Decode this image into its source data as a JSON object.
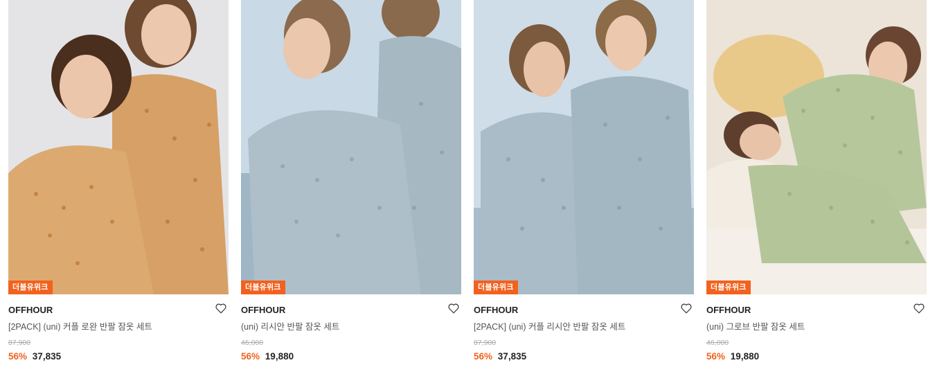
{
  "products": [
    {
      "badge": "더블유위크",
      "brand": "OFFHOUR",
      "name": "[2PACK] (uni) 커플 로완 반팔 잠옷 세트",
      "original_price": "87,900",
      "discount": "56%",
      "price": "37,835",
      "image": {
        "bg": "#e4e4e6",
        "garment": "#d9a66a",
        "pattern": "#b5651d",
        "skin": "#e8c3a8",
        "hair": "#5a3a26"
      }
    },
    {
      "badge": "더블유위크",
      "brand": "OFFHOUR",
      "name": "(uni) 리시안 반팔 잠옷 세트",
      "original_price": "46,000",
      "discount": "56%",
      "price": "19,880",
      "image": {
        "bg": "#c9d9e6",
        "garment": "#a6b8c2",
        "pattern": "#7e95a3",
        "skin": "#eac7ad",
        "hair": "#8b6a4e"
      }
    },
    {
      "badge": "더블유위크",
      "brand": "OFFHOUR",
      "name": "[2PACK] (uni) 커플 리시안 반팔 잠옷 세트",
      "original_price": "87,900",
      "discount": "56%",
      "price": "37,835",
      "image": {
        "bg": "#cfdde8",
        "garment": "#a3b7c3",
        "pattern": "#7a93a2",
        "skin": "#e8c3a8",
        "hair": "#7b5a3e"
      }
    },
    {
      "badge": "더블유위크",
      "brand": "OFFHOUR",
      "name": "(uni) 그로브 반팔 잠옷 세트",
      "original_price": "46,000",
      "discount": "56%",
      "price": "19,880",
      "image": {
        "bg": "#ece4d8",
        "garment": "#b5c59a",
        "pattern": "#8aa070",
        "skin": "#e8c3a8",
        "hair": "#6a4632"
      }
    }
  ]
}
